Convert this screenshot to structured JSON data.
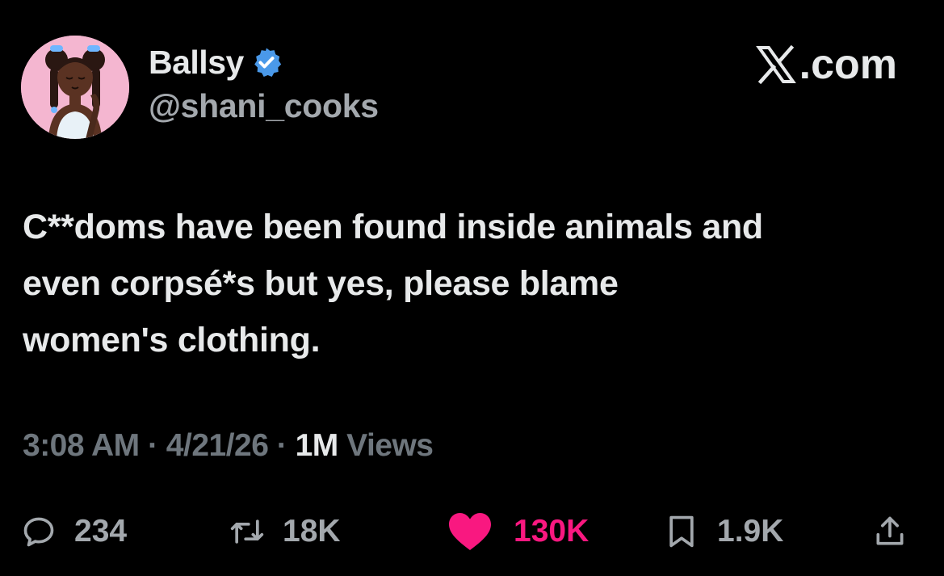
{
  "author": {
    "display_name": "Ballsy",
    "handle": "@shani_cooks",
    "verified": true,
    "verified_color": "#4a99e9"
  },
  "brand": {
    "label": ".com",
    "icon": "x-logo-icon"
  },
  "tweet": {
    "lines": [
      "C**doms have been found inside animals and",
      "even corpsé*s but yes, please blame",
      "women's clothing."
    ]
  },
  "meta": {
    "time": "3:08 AM",
    "separator": "·",
    "date": "4/21/26",
    "views_count": "1M",
    "views_label": "Views"
  },
  "actions": {
    "reply": {
      "icon": "reply-icon",
      "count": "234"
    },
    "retweet": {
      "icon": "retweet-icon",
      "count": "18K"
    },
    "like": {
      "icon": "heart-icon",
      "count": "130K",
      "liked": true,
      "color": "#f91880"
    },
    "bookmark": {
      "icon": "bookmark-icon",
      "count": "1.9K"
    },
    "share": {
      "icon": "share-icon"
    }
  },
  "colors": {
    "background": "#000000",
    "text": "#e7e9ea",
    "muted": "#6e767d",
    "action": "#a3a8ad"
  }
}
